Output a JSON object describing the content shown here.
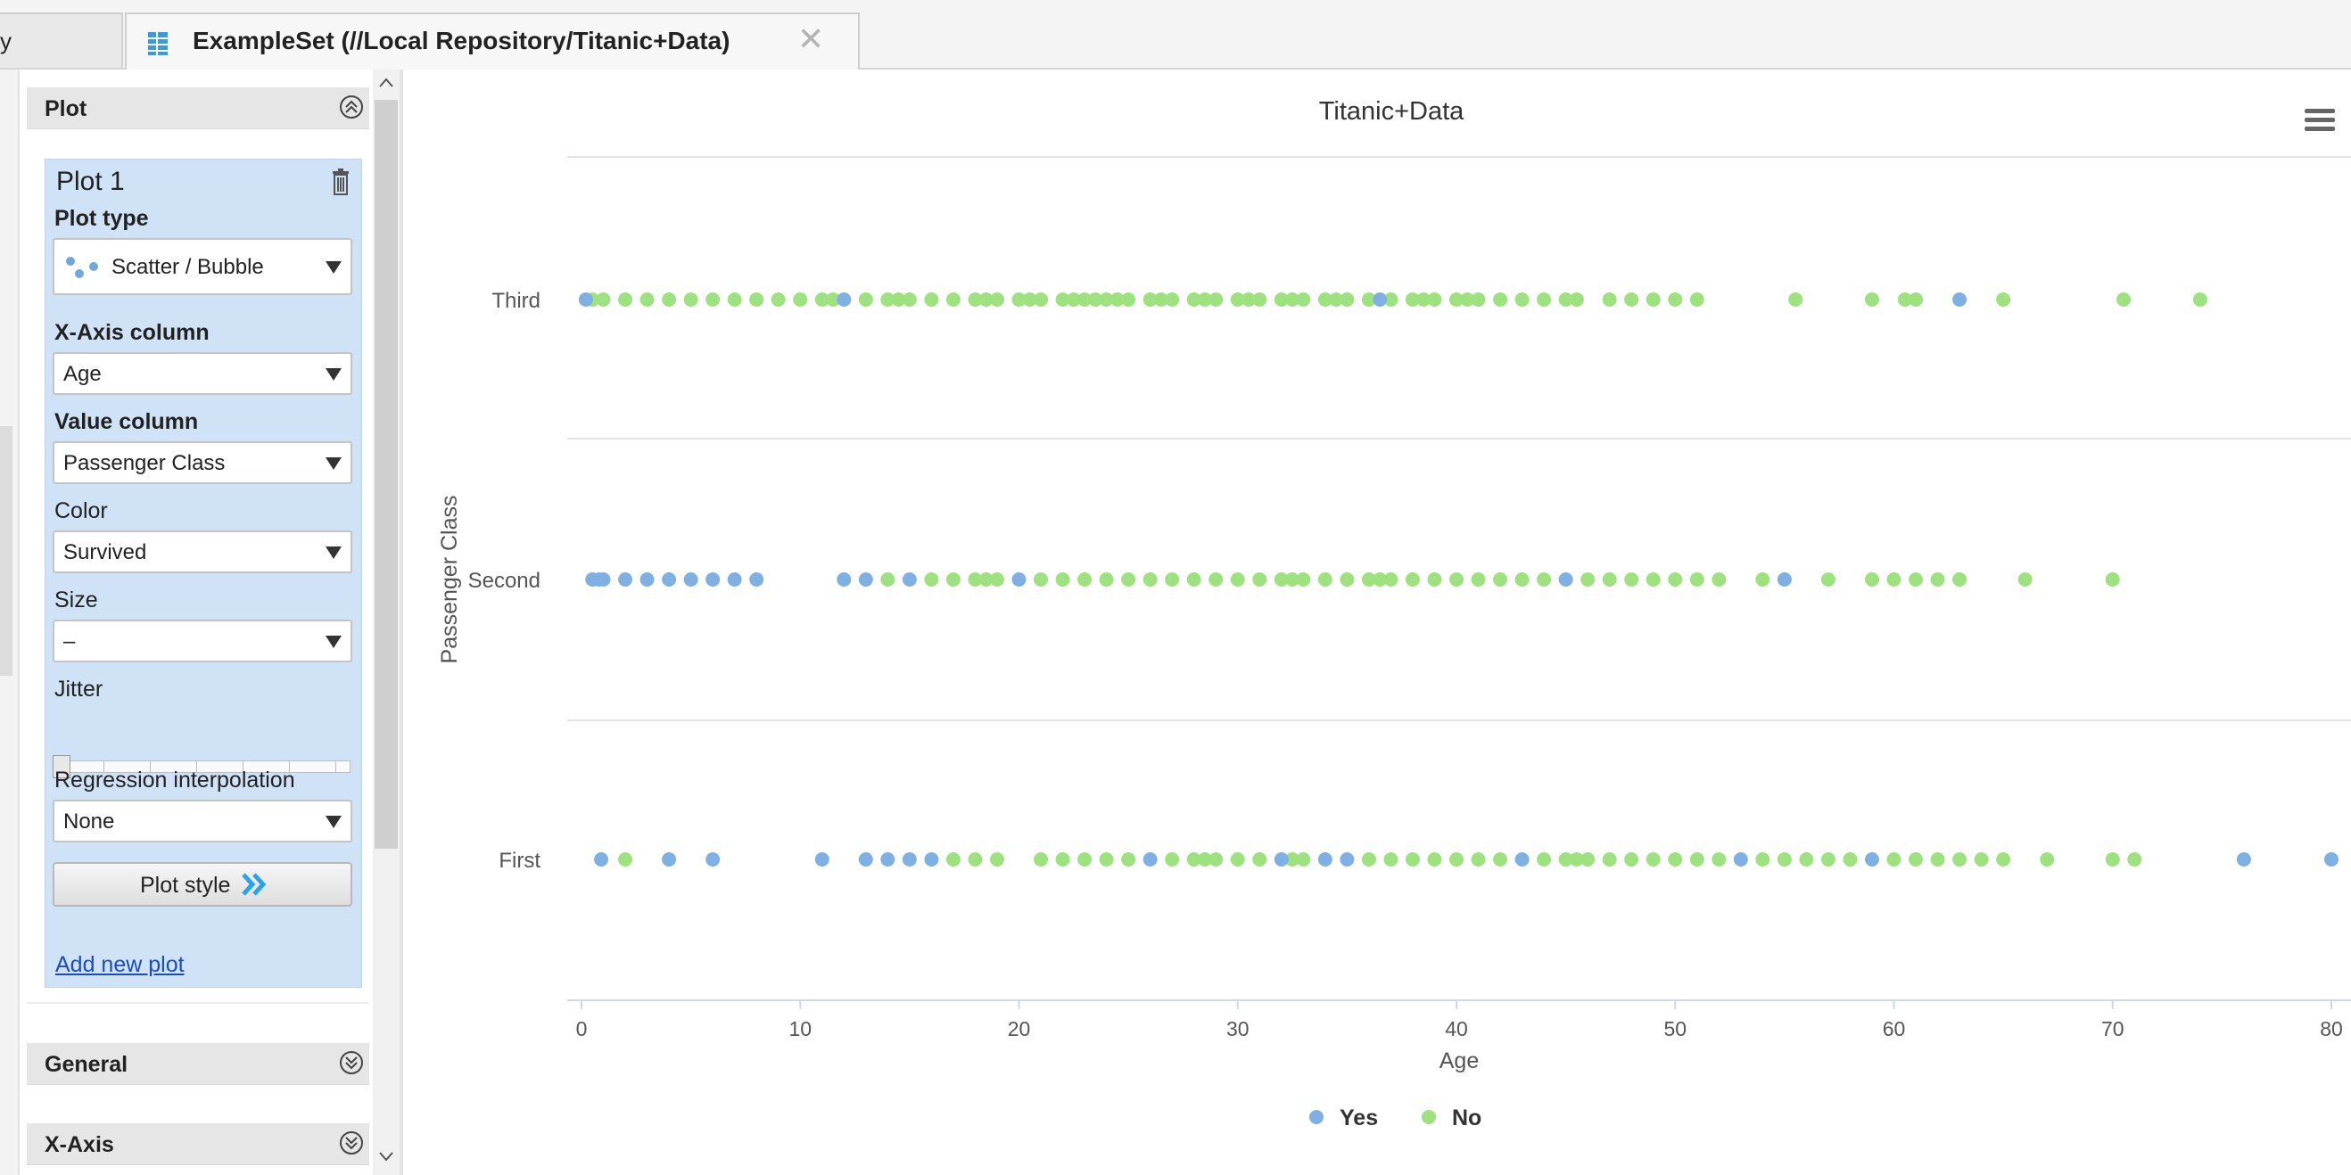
{
  "tabs": {
    "previous_label": "y",
    "active_title": "ExampleSet (//Local Repository/Titanic+Data)",
    "close_symbol": "✕"
  },
  "left_panel": {
    "plot_section_title": "Plot",
    "plot_title": "Plot 1",
    "plot_type_label": "Plot type",
    "plot_type_value": "Scatter / Bubble",
    "x_axis_label": "X-Axis column",
    "x_axis_value": "Age",
    "value_column_label": "Value column",
    "value_column_value": "Passenger Class",
    "color_label": "Color",
    "color_value": "Survived",
    "size_label": "Size",
    "size_value": "–",
    "jitter_label": "Jitter",
    "jitter_value": 0,
    "regression_label": "Regression interpolation",
    "regression_value": "None",
    "plot_style_button": "Plot style",
    "add_new_plot": "Add new plot",
    "general_section": "General",
    "x_axis_section": "X-Axis"
  },
  "chart_data": {
    "type": "scatter",
    "title": "Titanic+Data",
    "xlabel": "Age",
    "ylabel": "Passenger Class",
    "xlim": [
      0,
      80
    ],
    "x_ticks": [
      0,
      10,
      20,
      30,
      40,
      50,
      60,
      70,
      80
    ],
    "categories": [
      "Third",
      "Second",
      "First"
    ],
    "grid": true,
    "legend_position": "bottom",
    "series": [
      {
        "name": "Yes",
        "color": "#7fb0e4",
        "points": [
          {
            "x": 0.2,
            "y": "Third"
          },
          {
            "x": 12,
            "y": "Third"
          },
          {
            "x": 36.5,
            "y": "Third"
          },
          {
            "x": 63,
            "y": "Third"
          },
          {
            "x": 0.5,
            "y": "Second"
          },
          {
            "x": 0.8,
            "y": "Second"
          },
          {
            "x": 1,
            "y": "Second"
          },
          {
            "x": 2,
            "y": "Second"
          },
          {
            "x": 3,
            "y": "Second"
          },
          {
            "x": 4,
            "y": "Second"
          },
          {
            "x": 5,
            "y": "Second"
          },
          {
            "x": 6,
            "y": "Second"
          },
          {
            "x": 7,
            "y": "Second"
          },
          {
            "x": 8,
            "y": "Second"
          },
          {
            "x": 12,
            "y": "Second"
          },
          {
            "x": 13,
            "y": "Second"
          },
          {
            "x": 15,
            "y": "Second"
          },
          {
            "x": 20,
            "y": "Second"
          },
          {
            "x": 45,
            "y": "Second"
          },
          {
            "x": 55,
            "y": "Second"
          },
          {
            "x": 0.9,
            "y": "First"
          },
          {
            "x": 4,
            "y": "First"
          },
          {
            "x": 6,
            "y": "First"
          },
          {
            "x": 11,
            "y": "First"
          },
          {
            "x": 13,
            "y": "First"
          },
          {
            "x": 14,
            "y": "First"
          },
          {
            "x": 15,
            "y": "First"
          },
          {
            "x": 16,
            "y": "First"
          },
          {
            "x": 26,
            "y": "First"
          },
          {
            "x": 32,
            "y": "First"
          },
          {
            "x": 34,
            "y": "First"
          },
          {
            "x": 35,
            "y": "First"
          },
          {
            "x": 43,
            "y": "First"
          },
          {
            "x": 53,
            "y": "First"
          },
          {
            "x": 59,
            "y": "First"
          },
          {
            "x": 76,
            "y": "First"
          },
          {
            "x": 80,
            "y": "First"
          }
        ]
      },
      {
        "name": "No",
        "color": "#9ee27f",
        "points": [
          {
            "x": 0.5,
            "y": "Third"
          },
          {
            "x": 1,
            "y": "Third"
          },
          {
            "x": 2,
            "y": "Third"
          },
          {
            "x": 3,
            "y": "Third"
          },
          {
            "x": 4,
            "y": "Third"
          },
          {
            "x": 5,
            "y": "Third"
          },
          {
            "x": 6,
            "y": "Third"
          },
          {
            "x": 7,
            "y": "Third"
          },
          {
            "x": 8,
            "y": "Third"
          },
          {
            "x": 9,
            "y": "Third"
          },
          {
            "x": 10,
            "y": "Third"
          },
          {
            "x": 11,
            "y": "Third"
          },
          {
            "x": 11.5,
            "y": "Third"
          },
          {
            "x": 13,
            "y": "Third"
          },
          {
            "x": 14,
            "y": "Third"
          },
          {
            "x": 14.5,
            "y": "Third"
          },
          {
            "x": 15,
            "y": "Third"
          },
          {
            "x": 16,
            "y": "Third"
          },
          {
            "x": 17,
            "y": "Third"
          },
          {
            "x": 18,
            "y": "Third"
          },
          {
            "x": 18.5,
            "y": "Third"
          },
          {
            "x": 19,
            "y": "Third"
          },
          {
            "x": 20,
            "y": "Third"
          },
          {
            "x": 20.5,
            "y": "Third"
          },
          {
            "x": 21,
            "y": "Third"
          },
          {
            "x": 22,
            "y": "Third"
          },
          {
            "x": 22.5,
            "y": "Third"
          },
          {
            "x": 23,
            "y": "Third"
          },
          {
            "x": 23.5,
            "y": "Third"
          },
          {
            "x": 24,
            "y": "Third"
          },
          {
            "x": 24.5,
            "y": "Third"
          },
          {
            "x": 25,
            "y": "Third"
          },
          {
            "x": 26,
            "y": "Third"
          },
          {
            "x": 26.5,
            "y": "Third"
          },
          {
            "x": 27,
            "y": "Third"
          },
          {
            "x": 28,
            "y": "Third"
          },
          {
            "x": 28.5,
            "y": "Third"
          },
          {
            "x": 29,
            "y": "Third"
          },
          {
            "x": 30,
            "y": "Third"
          },
          {
            "x": 30.5,
            "y": "Third"
          },
          {
            "x": 31,
            "y": "Third"
          },
          {
            "x": 32,
            "y": "Third"
          },
          {
            "x": 32.5,
            "y": "Third"
          },
          {
            "x": 33,
            "y": "Third"
          },
          {
            "x": 34,
            "y": "Third"
          },
          {
            "x": 34.5,
            "y": "Third"
          },
          {
            "x": 35,
            "y": "Third"
          },
          {
            "x": 36,
            "y": "Third"
          },
          {
            "x": 37,
            "y": "Third"
          },
          {
            "x": 38,
            "y": "Third"
          },
          {
            "x": 38.5,
            "y": "Third"
          },
          {
            "x": 39,
            "y": "Third"
          },
          {
            "x": 40,
            "y": "Third"
          },
          {
            "x": 40.5,
            "y": "Third"
          },
          {
            "x": 41,
            "y": "Third"
          },
          {
            "x": 42,
            "y": "Third"
          },
          {
            "x": 43,
            "y": "Third"
          },
          {
            "x": 44,
            "y": "Third"
          },
          {
            "x": 45,
            "y": "Third"
          },
          {
            "x": 45.5,
            "y": "Third"
          },
          {
            "x": 47,
            "y": "Third"
          },
          {
            "x": 48,
            "y": "Third"
          },
          {
            "x": 49,
            "y": "Third"
          },
          {
            "x": 50,
            "y": "Third"
          },
          {
            "x": 51,
            "y": "Third"
          },
          {
            "x": 55.5,
            "y": "Third"
          },
          {
            "x": 59,
            "y": "Third"
          },
          {
            "x": 60.5,
            "y": "Third"
          },
          {
            "x": 61,
            "y": "Third"
          },
          {
            "x": 65,
            "y": "Third"
          },
          {
            "x": 70.5,
            "y": "Third"
          },
          {
            "x": 74,
            "y": "Third"
          },
          {
            "x": 14,
            "y": "Second"
          },
          {
            "x": 16,
            "y": "Second"
          },
          {
            "x": 17,
            "y": "Second"
          },
          {
            "x": 18,
            "y": "Second"
          },
          {
            "x": 18.5,
            "y": "Second"
          },
          {
            "x": 19,
            "y": "Second"
          },
          {
            "x": 21,
            "y": "Second"
          },
          {
            "x": 22,
            "y": "Second"
          },
          {
            "x": 23,
            "y": "Second"
          },
          {
            "x": 24,
            "y": "Second"
          },
          {
            "x": 25,
            "y": "Second"
          },
          {
            "x": 26,
            "y": "Second"
          },
          {
            "x": 27,
            "y": "Second"
          },
          {
            "x": 28,
            "y": "Second"
          },
          {
            "x": 29,
            "y": "Second"
          },
          {
            "x": 30,
            "y": "Second"
          },
          {
            "x": 31,
            "y": "Second"
          },
          {
            "x": 32,
            "y": "Second"
          },
          {
            "x": 32.5,
            "y": "Second"
          },
          {
            "x": 33,
            "y": "Second"
          },
          {
            "x": 34,
            "y": "Second"
          },
          {
            "x": 35,
            "y": "Second"
          },
          {
            "x": 36,
            "y": "Second"
          },
          {
            "x": 36.5,
            "y": "Second"
          },
          {
            "x": 37,
            "y": "Second"
          },
          {
            "x": 38,
            "y": "Second"
          },
          {
            "x": 39,
            "y": "Second"
          },
          {
            "x": 40,
            "y": "Second"
          },
          {
            "x": 41,
            "y": "Second"
          },
          {
            "x": 42,
            "y": "Second"
          },
          {
            "x": 43,
            "y": "Second"
          },
          {
            "x": 44,
            "y": "Second"
          },
          {
            "x": 46,
            "y": "Second"
          },
          {
            "x": 47,
            "y": "Second"
          },
          {
            "x": 48,
            "y": "Second"
          },
          {
            "x": 49,
            "y": "Second"
          },
          {
            "x": 50,
            "y": "Second"
          },
          {
            "x": 51,
            "y": "Second"
          },
          {
            "x": 52,
            "y": "Second"
          },
          {
            "x": 54,
            "y": "Second"
          },
          {
            "x": 57,
            "y": "Second"
          },
          {
            "x": 59,
            "y": "Second"
          },
          {
            "x": 60,
            "y": "Second"
          },
          {
            "x": 61,
            "y": "Second"
          },
          {
            "x": 62,
            "y": "Second"
          },
          {
            "x": 63,
            "y": "Second"
          },
          {
            "x": 66,
            "y": "Second"
          },
          {
            "x": 70,
            "y": "Second"
          },
          {
            "x": 2,
            "y": "First"
          },
          {
            "x": 17,
            "y": "First"
          },
          {
            "x": 18,
            "y": "First"
          },
          {
            "x": 19,
            "y": "First"
          },
          {
            "x": 21,
            "y": "First"
          },
          {
            "x": 22,
            "y": "First"
          },
          {
            "x": 23,
            "y": "First"
          },
          {
            "x": 24,
            "y": "First"
          },
          {
            "x": 25,
            "y": "First"
          },
          {
            "x": 27,
            "y": "First"
          },
          {
            "x": 28,
            "y": "First"
          },
          {
            "x": 28.5,
            "y": "First"
          },
          {
            "x": 29,
            "y": "First"
          },
          {
            "x": 30,
            "y": "First"
          },
          {
            "x": 31,
            "y": "First"
          },
          {
            "x": 32.5,
            "y": "First"
          },
          {
            "x": 33,
            "y": "First"
          },
          {
            "x": 36,
            "y": "First"
          },
          {
            "x": 37,
            "y": "First"
          },
          {
            "x": 38,
            "y": "First"
          },
          {
            "x": 39,
            "y": "First"
          },
          {
            "x": 40,
            "y": "First"
          },
          {
            "x": 41,
            "y": "First"
          },
          {
            "x": 42,
            "y": "First"
          },
          {
            "x": 44,
            "y": "First"
          },
          {
            "x": 45,
            "y": "First"
          },
          {
            "x": 45.5,
            "y": "First"
          },
          {
            "x": 46,
            "y": "First"
          },
          {
            "x": 47,
            "y": "First"
          },
          {
            "x": 48,
            "y": "First"
          },
          {
            "x": 49,
            "y": "First"
          },
          {
            "x": 50,
            "y": "First"
          },
          {
            "x": 51,
            "y": "First"
          },
          {
            "x": 52,
            "y": "First"
          },
          {
            "x": 54,
            "y": "First"
          },
          {
            "x": 55,
            "y": "First"
          },
          {
            "x": 56,
            "y": "First"
          },
          {
            "x": 57,
            "y": "First"
          },
          {
            "x": 58,
            "y": "First"
          },
          {
            "x": 60,
            "y": "First"
          },
          {
            "x": 61,
            "y": "First"
          },
          {
            "x": 62,
            "y": "First"
          },
          {
            "x": 63,
            "y": "First"
          },
          {
            "x": 64,
            "y": "First"
          },
          {
            "x": 65,
            "y": "First"
          },
          {
            "x": 67,
            "y": "First"
          },
          {
            "x": 70,
            "y": "First"
          },
          {
            "x": 71,
            "y": "First"
          }
        ]
      }
    ]
  }
}
